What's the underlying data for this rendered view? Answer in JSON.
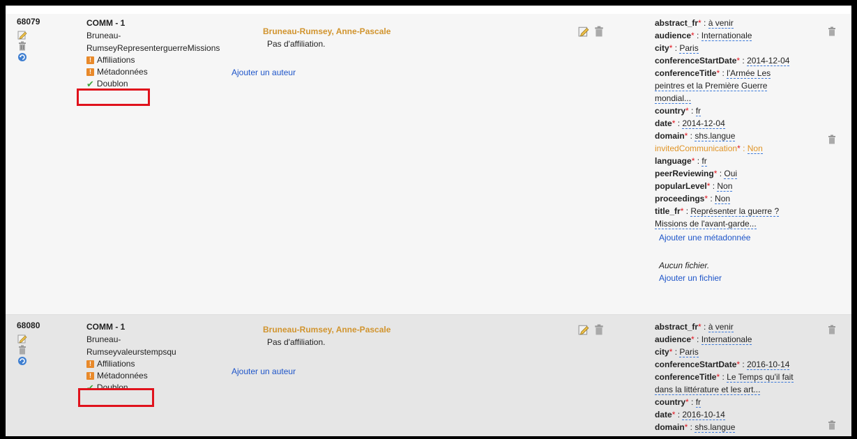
{
  "records": [
    {
      "id": "68079",
      "type": "COMM - 1",
      "title_lines": [
        "Bruneau-",
        "RumseyRepresenterguerreMissions"
      ],
      "status_affiliations": "Affiliations",
      "status_metadata": "Métadonnées",
      "status_doublon": "Doublon",
      "author": "Bruneau-Rumsey, Anne-Pascale",
      "affiliation": "Pas d'affiliation.",
      "add_author": "Ajouter un auteur",
      "metadata": [
        {
          "key": "abstract_fr",
          "value": "à venir"
        },
        {
          "key": "audience",
          "value": "Internationale"
        },
        {
          "key": "city",
          "value": "Paris"
        },
        {
          "key": "conferenceStartDate",
          "value": "2014-12-04"
        },
        {
          "key": "conferenceTitle",
          "value": "l'Armée Les",
          "cont": [
            "peintres et la Première Guerre",
            "mondial..."
          ]
        },
        {
          "key": "country",
          "value": "fr"
        },
        {
          "key": "date",
          "value": "2014-12-04"
        },
        {
          "key": "domain",
          "value": "shs.langue"
        },
        {
          "key": "invitedCommunication",
          "value": "Non",
          "highlight": true
        },
        {
          "key": "language",
          "value": "fr"
        },
        {
          "key": "peerReviewing",
          "value": "Oui"
        },
        {
          "key": "popularLevel",
          "value": "Non"
        },
        {
          "key": "proceedings",
          "value": "Non"
        },
        {
          "key": "title_fr",
          "value": "Représenter la guerre ?",
          "cont": [
            "Missions de l'avant-garde..."
          ]
        }
      ],
      "add_metadata": "Ajouter une métadonnée",
      "no_file": "Aucun fichier.",
      "add_file": "Ajouter un fichier"
    },
    {
      "id": "68080",
      "type": "COMM - 1",
      "title_lines": [
        "Bruneau-",
        "Rumseyvaleurstempsqu"
      ],
      "status_affiliations": "Affiliations",
      "status_metadata": "Métadonnées",
      "status_doublon": "Doublon",
      "author": "Bruneau-Rumsey, Anne-Pascale",
      "affiliation": "Pas d'affiliation.",
      "add_author": "Ajouter un auteur",
      "metadata": [
        {
          "key": "abstract_fr",
          "value": "à venir"
        },
        {
          "key": "audience",
          "value": "Internationale"
        },
        {
          "key": "city",
          "value": "Paris"
        },
        {
          "key": "conferenceStartDate",
          "value": "2016-10-14"
        },
        {
          "key": "conferenceTitle",
          "value": "Le Temps qu'il fait",
          "cont": [
            "dans la littérature et les art..."
          ]
        },
        {
          "key": "country",
          "value": "fr"
        },
        {
          "key": "date",
          "value": "2016-10-14"
        },
        {
          "key": "domain",
          "value": "shs.langue"
        }
      ]
    }
  ],
  "colors": {
    "author": "#d1942e",
    "link": "#1e55c9",
    "highlight_box": "#e0121c",
    "required_star": "#e0121c",
    "warning": "#e8892a",
    "check": "#3da53d"
  }
}
